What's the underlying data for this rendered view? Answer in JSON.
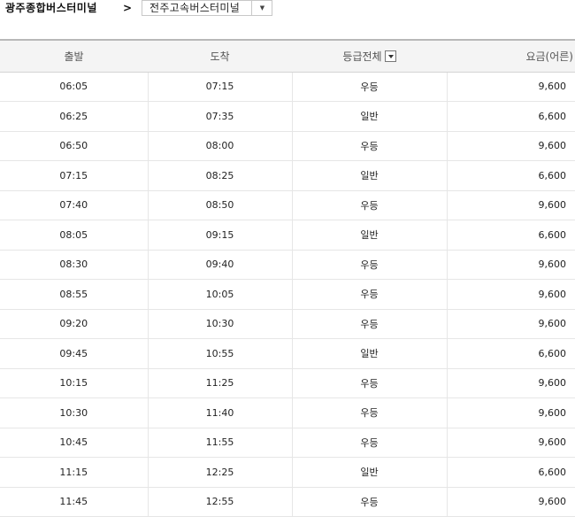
{
  "route": {
    "origin": "광주종합버스터미널",
    "arrow": ">",
    "destination": "전주고속버스터미널"
  },
  "table": {
    "headers": {
      "departure": "출발",
      "arrival": "도착",
      "grade": "등급전체",
      "fare": "요금(어른)"
    },
    "rows": [
      {
        "departure": "06:05",
        "arrival": "07:15",
        "grade": "우등",
        "fare": "9,600"
      },
      {
        "departure": "06:25",
        "arrival": "07:35",
        "grade": "일반",
        "fare": "6,600"
      },
      {
        "departure": "06:50",
        "arrival": "08:00",
        "grade": "우등",
        "fare": "9,600"
      },
      {
        "departure": "07:15",
        "arrival": "08:25",
        "grade": "일반",
        "fare": "6,600"
      },
      {
        "departure": "07:40",
        "arrival": "08:50",
        "grade": "우등",
        "fare": "9,600"
      },
      {
        "departure": "08:05",
        "arrival": "09:15",
        "grade": "일반",
        "fare": "6,600"
      },
      {
        "departure": "08:30",
        "arrival": "09:40",
        "grade": "우등",
        "fare": "9,600"
      },
      {
        "departure": "08:55",
        "arrival": "10:05",
        "grade": "우등",
        "fare": "9,600"
      },
      {
        "departure": "09:20",
        "arrival": "10:30",
        "grade": "우등",
        "fare": "9,600"
      },
      {
        "departure": "09:45",
        "arrival": "10:55",
        "grade": "일반",
        "fare": "6,600"
      },
      {
        "departure": "10:15",
        "arrival": "11:25",
        "grade": "우등",
        "fare": "9,600"
      },
      {
        "departure": "10:30",
        "arrival": "11:40",
        "grade": "우등",
        "fare": "9,600"
      },
      {
        "departure": "10:45",
        "arrival": "11:55",
        "grade": "우등",
        "fare": "9,600"
      },
      {
        "departure": "11:15",
        "arrival": "12:25",
        "grade": "일반",
        "fare": "6,600"
      },
      {
        "departure": "11:45",
        "arrival": "12:55",
        "grade": "우등",
        "fare": "9,600"
      }
    ]
  },
  "icons": {
    "destination_dropdown": "caret-down-icon",
    "grade_filter": "filter-dropdown-icon"
  },
  "colors": {
    "header_background": "#f4f4f4",
    "header_top_border": "#b8b8b8",
    "row_divider": "#e6e6e6"
  }
}
